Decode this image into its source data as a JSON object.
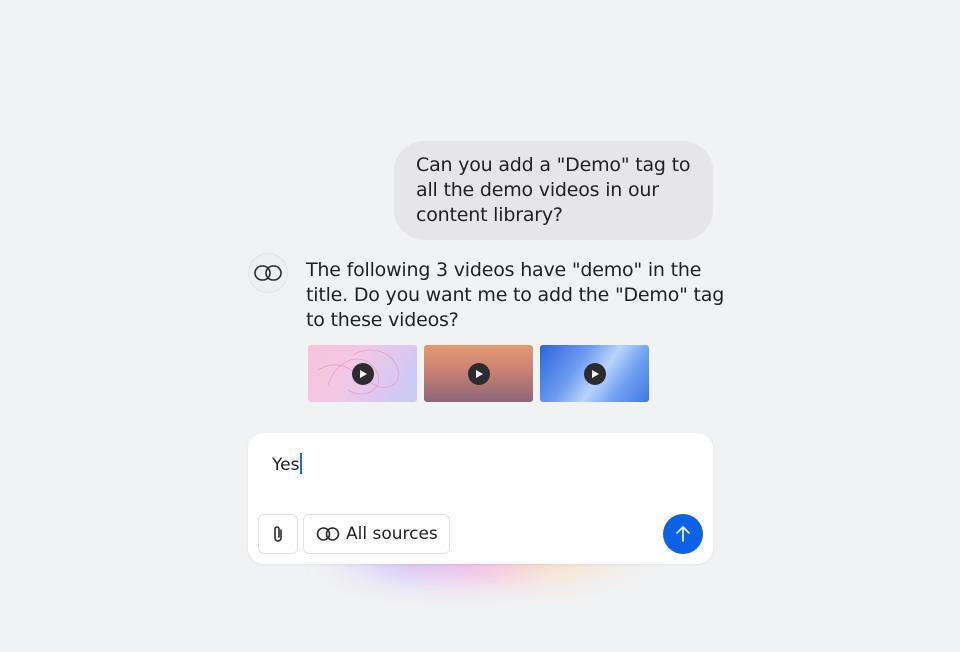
{
  "conversation": {
    "user_message": "Can you add a \"Demo\" tag to all the demo videos in our content library?",
    "assistant_message": "The following 3 videos have \"demo\" in the title. Do you want me to add the \"Demo\" tag to these videos?",
    "videos": [
      {
        "icon": "play-icon"
      },
      {
        "icon": "play-icon"
      },
      {
        "icon": "play-icon"
      }
    ]
  },
  "composer": {
    "input_value": "Yes",
    "attach_icon": "paperclip-icon",
    "sources_label": "All sources",
    "sources_icon": "link-icon",
    "send_icon": "arrow-up-icon"
  },
  "colors": {
    "accent": "#0b62e8",
    "background": "#f1f2f4",
    "user_bubble": "#e6e6e9"
  }
}
